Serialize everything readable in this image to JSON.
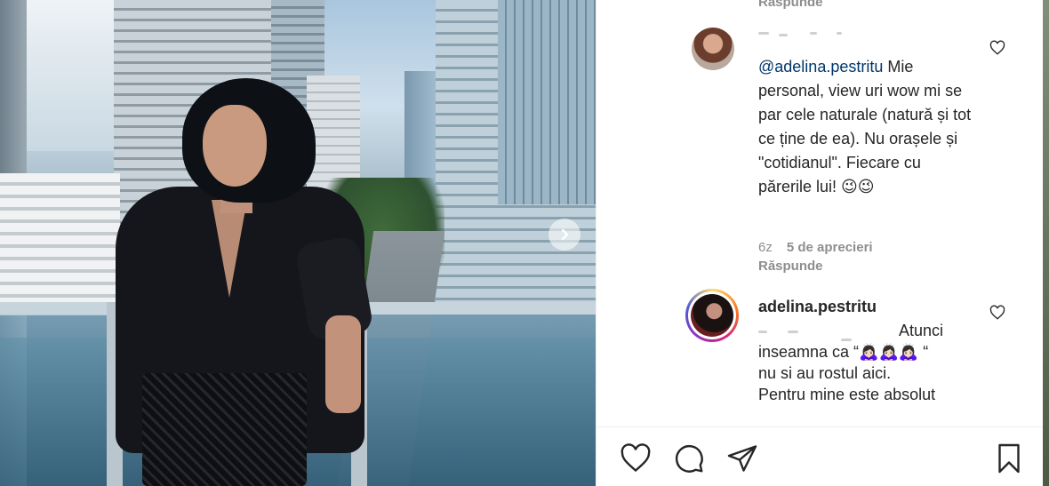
{
  "photo": {
    "next_icon": "chevron-right-icon"
  },
  "comments": {
    "top_reply_label": "Răspunde",
    "items": [
      {
        "avatar": "user-avatar",
        "mention": "@adelina.pestritu",
        "text": " Mie personal, view uri wow mi se par cele naturale (natură și tot ce ține de ea). Nu orașele și \"cotidianul\". Fiecare cu părerile lui! 😉😉",
        "time": "6z",
        "likes": "5 de aprecieri",
        "reply_label": "Răspunde",
        "like_icon": "heart-outline-icon"
      },
      {
        "avatar": "story-avatar",
        "username": "adelina.pestritu",
        "text_lines": [
          "Atunci",
          "inseamna ca “🙇🏻‍♀️🙇🏻‍♀️🙇🏻‍♀️ “",
          "nu si au rostul aici.",
          "Pentru mine este absolut"
        ],
        "like_icon": "heart-outline-icon"
      }
    ]
  },
  "actions": {
    "like_icon": "heart-outline-icon",
    "comment_icon": "speech-bubble-icon",
    "share_icon": "paper-plane-icon",
    "save_icon": "bookmark-icon"
  }
}
